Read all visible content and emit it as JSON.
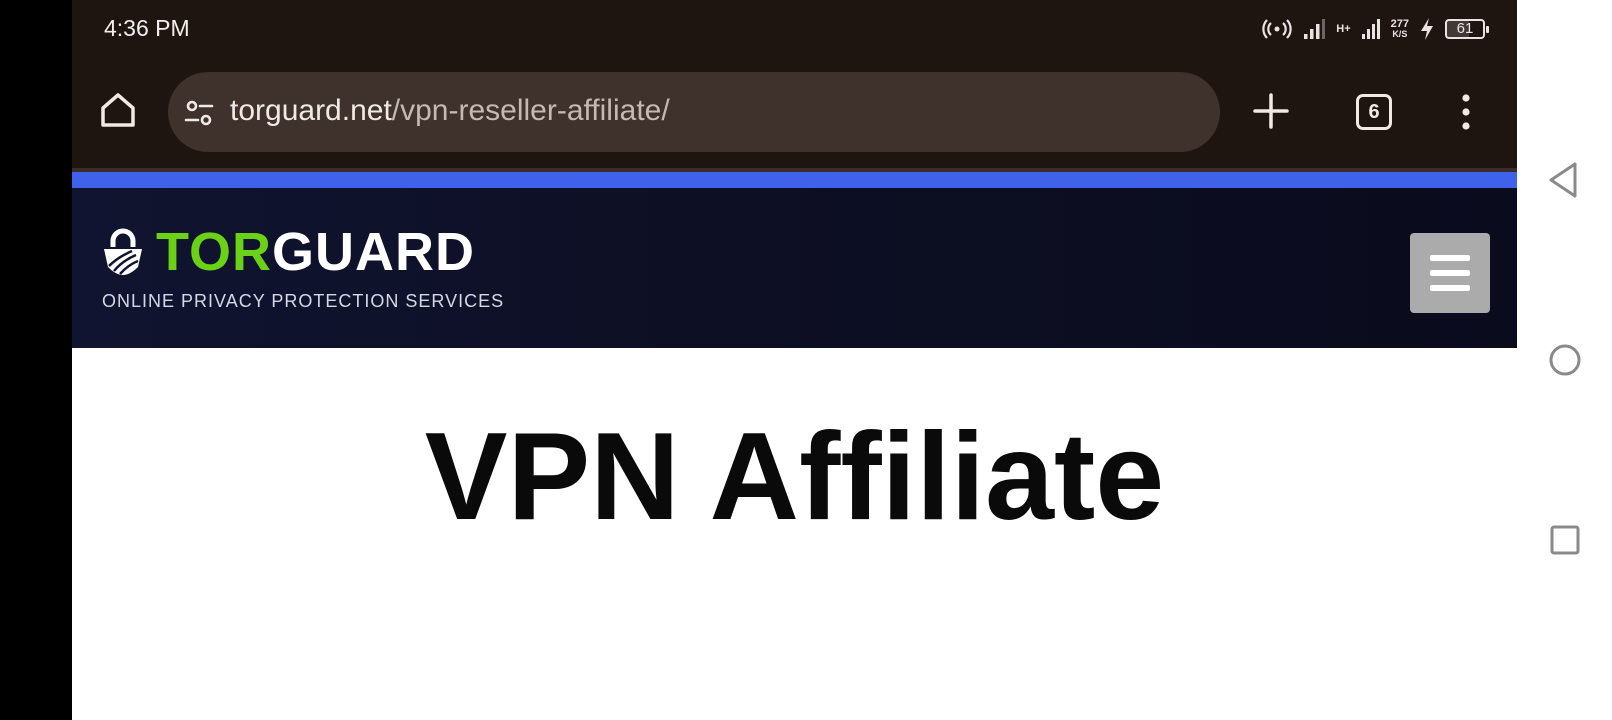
{
  "status": {
    "time": "4:36 PM",
    "network_type": "H+",
    "speed_value": "277",
    "speed_unit": "K/S",
    "battery": "61"
  },
  "browser": {
    "url_domain": "torguard.net",
    "url_path": "/vpn-reseller-affiliate/",
    "tab_count": "6"
  },
  "site": {
    "logo_tor": "TOR",
    "logo_guard": "GUARD",
    "tagline": "ONLINE PRIVACY PROTECTION SERVICES",
    "page_title": "VPN Affiliate"
  },
  "colors": {
    "browser_chrome": "#1e1410",
    "url_bar": "#3f312b",
    "accent_blue": "#4062ea",
    "header_bg": "#0d0f24",
    "logo_green": "#6ad116",
    "menu_button": "#ababab"
  },
  "icons": {
    "home": "home-icon",
    "site_settings": "tune-icon",
    "new_tab": "plus-icon",
    "menu": "more-vert-icon",
    "hamburger": "hamburger-icon",
    "back": "back-triangle-icon",
    "home_nav": "circle-home-icon",
    "recents": "square-recents-icon"
  }
}
